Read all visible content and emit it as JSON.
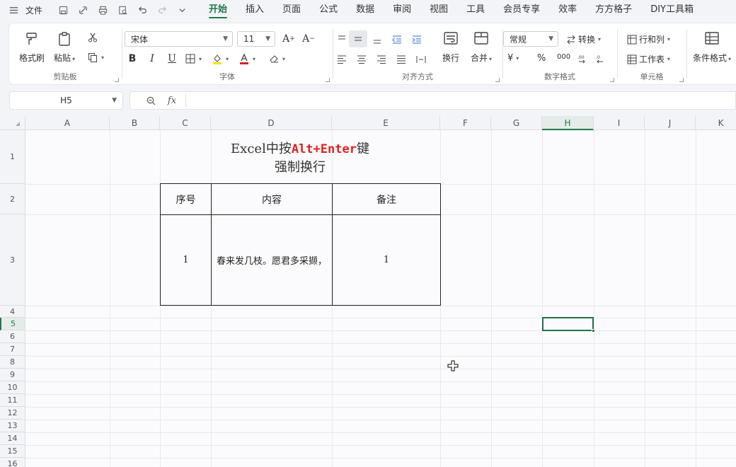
{
  "menubar": {
    "file_label": "文件",
    "tabs": [
      "开始",
      "插入",
      "页面",
      "公式",
      "数据",
      "审阅",
      "视图",
      "工具",
      "会员专享",
      "效率",
      "方方格子",
      "DIY工具箱"
    ],
    "active_tab": "开始"
  },
  "ribbon": {
    "clipboard": {
      "format_painter": "格式刷",
      "paste": "粘贴",
      "label": "剪贴板"
    },
    "font": {
      "name": "宋体",
      "size": "11",
      "bold": "B",
      "italic": "I",
      "underline": "U",
      "label": "字体"
    },
    "alignment": {
      "wrap": "换行",
      "merge": "合并",
      "label": "对齐方式"
    },
    "number": {
      "format": "常规",
      "convert": "转换",
      "currency": "¥",
      "percent": "%",
      "thousands": "000",
      "label": "数字格式"
    },
    "cells": {
      "row_col": "行和列",
      "worksheet": "工作表",
      "label": "单元格"
    },
    "styles": {
      "conditional": "条件格式"
    }
  },
  "namebox": {
    "value": "H5"
  },
  "formula": {
    "fx": "fx",
    "value": ""
  },
  "grid": {
    "columns": [
      "A",
      "B",
      "C",
      "D",
      "E",
      "F",
      "G",
      "H",
      "I",
      "J",
      "K"
    ],
    "rows": [
      "1",
      "2",
      "3",
      "4",
      "5",
      "6",
      "7",
      "8",
      "9",
      "10",
      "11",
      "12",
      "13",
      "14",
      "15",
      "16"
    ],
    "selected_col": "H",
    "selected_row": "5"
  },
  "content": {
    "title_prefix": "Excel中按",
    "title_key": "Alt+Enter",
    "title_suffix": "键",
    "title_line2": "强制换行",
    "table_headers": [
      "序号",
      "内容",
      "备注"
    ],
    "row1": {
      "no": "1",
      "content": "春来发几枝。愿君多采撷，",
      "note": "1"
    }
  }
}
